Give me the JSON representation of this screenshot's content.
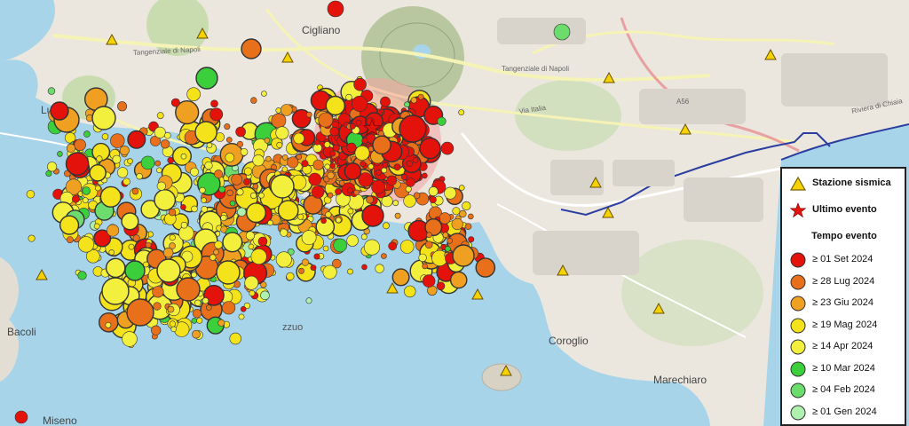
{
  "map": {
    "place_labels": {
      "cigliano": "Cigliano",
      "coroglio": "Coroglio",
      "marechiaro": "Marechiaro",
      "bacoli": "Bacoli",
      "miseno": "Miseno",
      "lu": "Lu",
      "pozzuoli_fragment": "zzuo"
    },
    "road_labels": {
      "tangenziale_west": "Tangenziale di Napoli",
      "tangenziale_east": "Tangenziale di Napoli",
      "via_italia": "Via Italia",
      "a56": "A56",
      "riviera": "Riviera di Chiaia"
    },
    "colors": {
      "sea": "#a8d4ea",
      "land": "#ebe7df",
      "park": "#c9dcb0",
      "crater": "#b9c7a0",
      "road": "#f6f3b6",
      "motorway": "#e8a0a0",
      "railway": "#2b3ea0",
      "station_fill": "#f5d200"
    },
    "epicenter_zone_colors": [
      "#f5a3a3",
      "#f9c7a4",
      "#b8e6c0"
    ]
  },
  "legend": {
    "station_label": "Stazione sismica",
    "last_event_label": "Ultimo evento",
    "title": "Tempo evento",
    "entries": [
      {
        "label": "≥ 01 Set 2024",
        "color": "#e3120b"
      },
      {
        "label": "≥ 28 Lug 2024",
        "color": "#e8701a"
      },
      {
        "label": "≥ 23 Giu 2024",
        "color": "#f0a020"
      },
      {
        "label": "≥ 19 Mag 2024",
        "color": "#f4e21a"
      },
      {
        "label": "≥ 14 Apr 2024",
        "color": "#f2f03c"
      },
      {
        "label": "≥ 10 Mar 2024",
        "color": "#3ccf3c"
      },
      {
        "label": "≥ 04 Feb 2024",
        "color": "#6cdd6c"
      },
      {
        "label": "≥ 01 Gen 2024",
        "color": "#aef0ae"
      }
    ]
  }
}
